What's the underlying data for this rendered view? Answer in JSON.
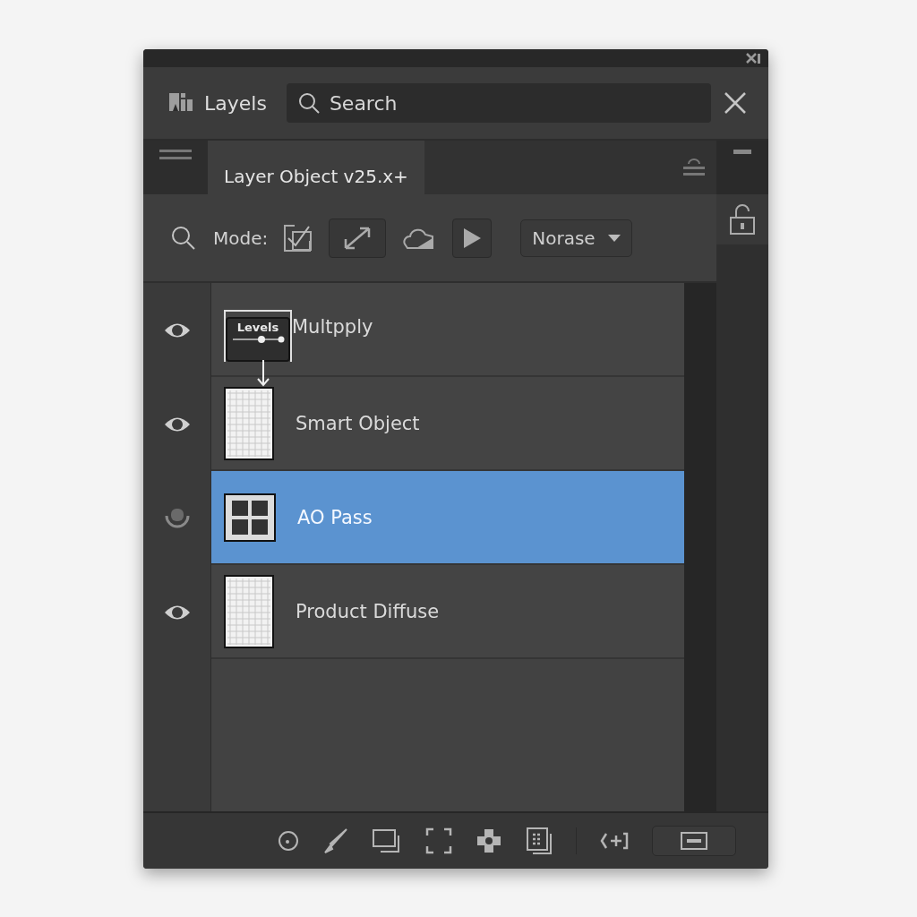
{
  "panel": {
    "title": "Layels",
    "search": {
      "placeholder": "Search"
    }
  },
  "tabs": [
    {
      "label": "Layer Object v25.x+",
      "selected": true
    }
  ],
  "toolbar": {
    "mode_label": "Mode:",
    "blend_mode": "Norase"
  },
  "layers": [
    {
      "name": "Multpply",
      "visible": true,
      "selected": false,
      "thumbnail": {
        "kind": "adjustment",
        "label": "Levels"
      }
    },
    {
      "name": "Smart Object",
      "visible": true,
      "selected": false,
      "thumbnail": {
        "kind": "grid"
      }
    },
    {
      "name": "AO Pass",
      "visible": false,
      "selected": true,
      "thumbnail": {
        "kind": "tiles"
      }
    },
    {
      "name": "Product Diffuse",
      "visible": true,
      "selected": false,
      "thumbnail": {
        "kind": "grid"
      }
    }
  ]
}
